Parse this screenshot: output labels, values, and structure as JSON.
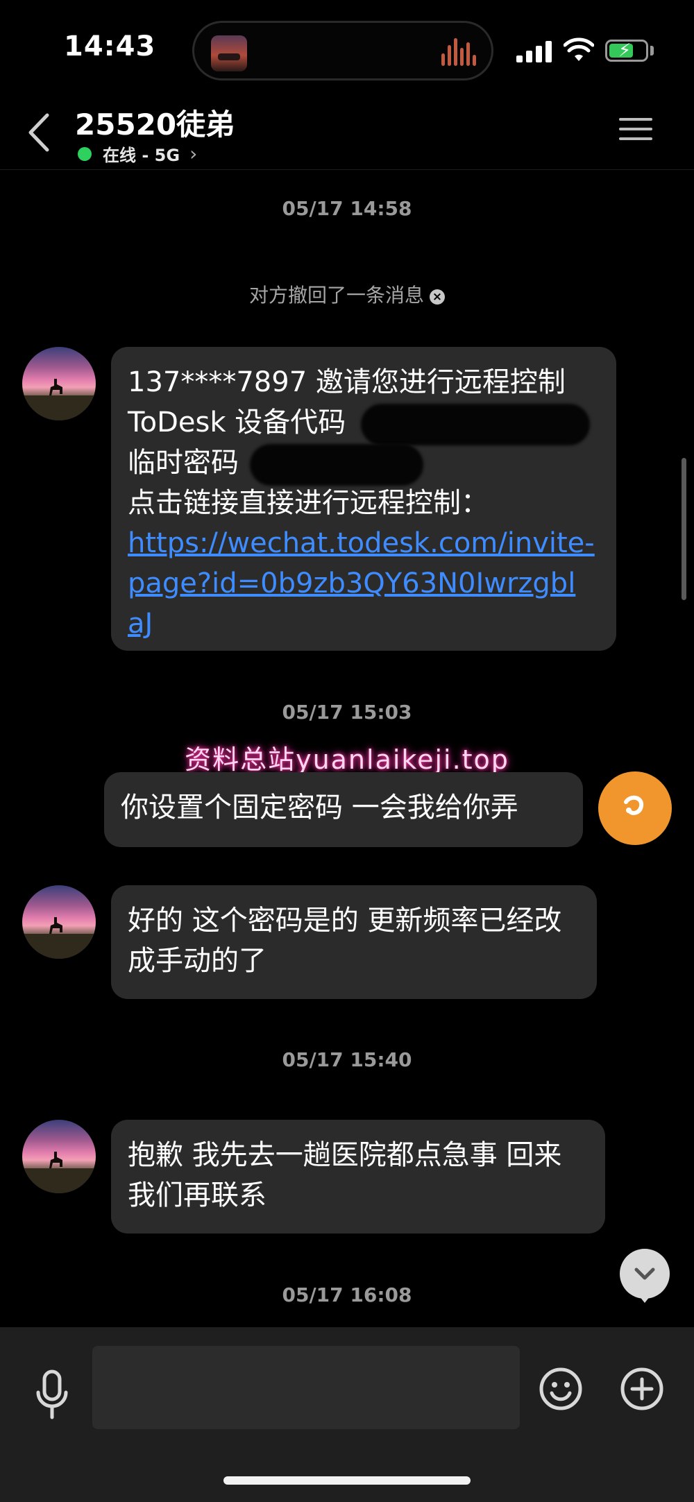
{
  "status_bar": {
    "time": "14:43"
  },
  "header": {
    "contact_name": "25520徒弟",
    "presence": "在线 - 5G",
    "colors": {
      "online": "#2ed15e"
    }
  },
  "messages": {
    "timestamp_1": "05/17 14:58",
    "recall_notice": "对方撤回了一条消息",
    "msg1_line1": "137****7897 邀请您进行远程控制",
    "msg1_line2": "ToDesk 设备代码",
    "msg1_line3": "临时密码",
    "msg1_line4": "点击链接直接进行远程控制：",
    "msg1_link": "https://wechat.todesk.com/invite-page?id=0b9zb3QY63N0Iwrzgbl aJ",
    "timestamp_2": "05/17 15:03",
    "msg2_text": "你设置个固定密码 一会我给你弄",
    "msg3_text": "好的 这个密码是的 更新频率已经改成手动的了",
    "timestamp_3": "05/17 15:40",
    "msg4_text": "抱歉 我先去一趟医院都点急事  回来我们再联系",
    "timestamp_4": "05/17 16:08"
  },
  "watermark": "资料总站yuanlaikeji.top",
  "input": {
    "value": "",
    "placeholder": ""
  },
  "icons": [
    "back-chevron-icon",
    "menu-icon",
    "microphone-icon",
    "emoji-icon",
    "plus-icon",
    "chevron-down-icon"
  ]
}
